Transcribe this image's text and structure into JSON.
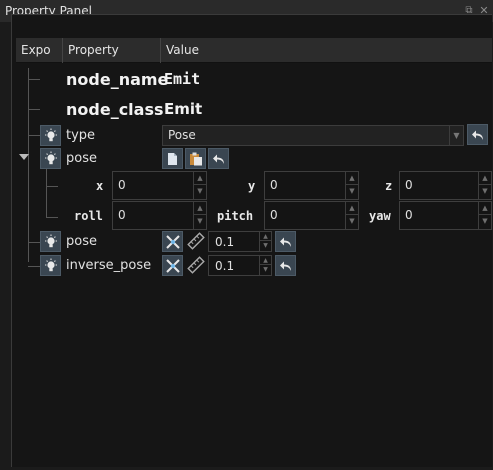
{
  "window": {
    "title": "Property Panel",
    "float_icon": "float-icon",
    "close_icon": "close-icon"
  },
  "columns": [
    "Expo",
    "Property",
    "Value"
  ],
  "node_name": {
    "label": "node_name",
    "value": "Emit"
  },
  "node_class": {
    "label": "node_class",
    "value": "Emit"
  },
  "type": {
    "label": "type",
    "value": "Pose"
  },
  "pose_group": {
    "label": "pose",
    "x": {
      "label": "x",
      "value": "0"
    },
    "y": {
      "label": "y",
      "value": "0"
    },
    "z": {
      "label": "z",
      "value": "0"
    },
    "roll": {
      "label": "roll",
      "value": "0"
    },
    "pitch": {
      "label": "pitch",
      "value": "0"
    },
    "yaw": {
      "label": "yaw",
      "value": "0"
    }
  },
  "pose_scale": {
    "label": "pose",
    "value": "0.1"
  },
  "inverse_pose": {
    "label": "inverse_pose",
    "value": "0.1"
  },
  "colors": {
    "accent_button": "#3a4651",
    "background": "#151515",
    "header": "#2c2c2c"
  }
}
